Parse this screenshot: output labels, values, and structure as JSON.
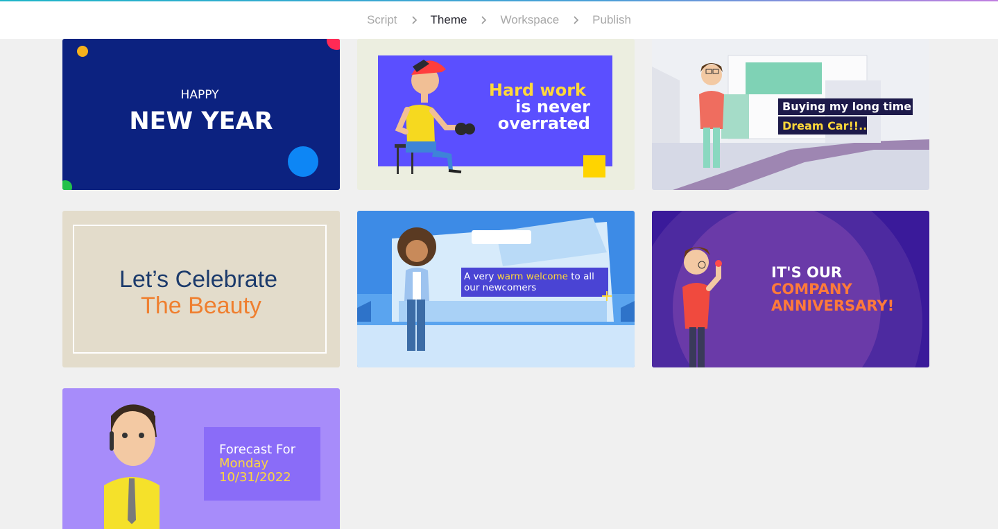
{
  "steps": [
    {
      "label": "Script",
      "active": false
    },
    {
      "label": "Theme",
      "active": true
    },
    {
      "label": "Workspace",
      "active": false
    },
    {
      "label": "Publish",
      "active": false
    }
  ],
  "templates": [
    {
      "line1": "HAPPY",
      "line2": "NEW YEAR",
      "bg": "#0c2280"
    },
    {
      "line1": "Hard work",
      "line2": "is never",
      "line3": "overrated",
      "bg": "#5b4fff"
    },
    {
      "line1": "Buying my long time",
      "line2": "Dream Car!!..",
      "bg": "#e9ecf2"
    },
    {
      "line1": "Let’s Celebrate",
      "line2": "The Beauty",
      "bg": "#e3dccb"
    },
    {
      "line1a": "A very ",
      "line1b": "warm welcome",
      "line1c": " to all",
      "line2": "our newcomers",
      "bg": "#3d8be6"
    },
    {
      "line1": "IT'S OUR",
      "line2": "COMPANY",
      "line3": "ANNIVERSARY!",
      "bg": "#4d2aa0"
    },
    {
      "line1": "Forecast For",
      "line2": "Monday",
      "line3": "10/31/2022",
      "bg": "#a78cfa"
    }
  ],
  "colors": {
    "accent_yellow": "#ffd83a",
    "accent_orange": "#ff7a3a",
    "navy": "#1b3a6b"
  }
}
